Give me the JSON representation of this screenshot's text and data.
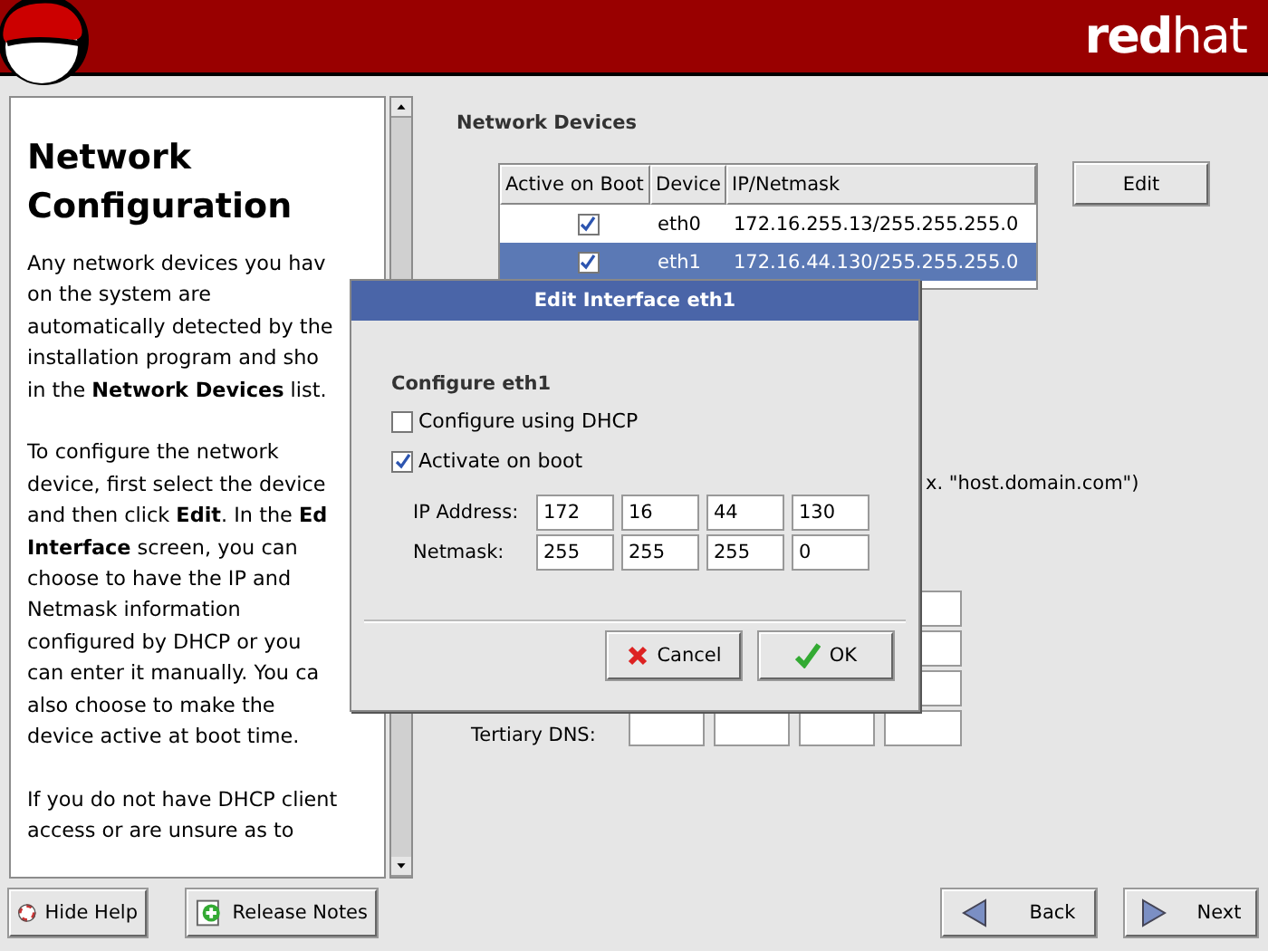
{
  "header": {
    "brand": "**red**hat"
  },
  "help": {
    "title": "Network Configuration",
    "paragraphs": [
      [
        "Any network devices you hav",
        "on the system are",
        "automatically detected by the",
        "installation program and sho",
        "in the **Network Devices** list."
      ],
      [
        "To configure the network",
        "device, first select the device",
        "and then click **Edit**. In the **Ed**",
        "**Interface** screen, you can",
        "choose to have the IP and",
        "Netmask information",
        "configured by DHCP or you",
        "can enter it manually. You ca",
        "also choose to make the",
        "device active at boot time."
      ],
      [
        "If you do not have DHCP client",
        "access or are unsure as to"
      ]
    ]
  },
  "devices": {
    "title": "Network Devices",
    "columns": [
      "Active on Boot",
      "Device",
      "IP/Netmask"
    ],
    "rows": [
      {
        "active": true,
        "device": "eth0",
        "ip": "172.16.255.13/255.255.255.0",
        "selected": false
      },
      {
        "active": true,
        "device": "eth1",
        "ip": "172.16.44.130/255.255.255.0",
        "selected": true
      }
    ],
    "edit_button": "Edit"
  },
  "hostname_hint": "x. \"host.domain.com\")",
  "dns": {
    "tertiary_label": "Tertiary DNS:"
  },
  "dialog": {
    "title": "Edit Interface eth1",
    "section": "Configure eth1",
    "options": [
      {
        "label": "Configure using DHCP",
        "checked": false
      },
      {
        "label": "Activate on boot",
        "checked": true
      }
    ],
    "fields": [
      {
        "label": "IP Address:",
        "octets": [
          "172",
          "16",
          "44",
          "130"
        ]
      },
      {
        "label": "Netmask:",
        "octets": [
          "255",
          "255",
          "255",
          "0"
        ]
      }
    ],
    "cancel": "Cancel",
    "ok": "OK"
  },
  "footer": {
    "hide_help": "Hide Help",
    "release_notes": "Release Notes",
    "back": "Back",
    "next": "Next"
  }
}
